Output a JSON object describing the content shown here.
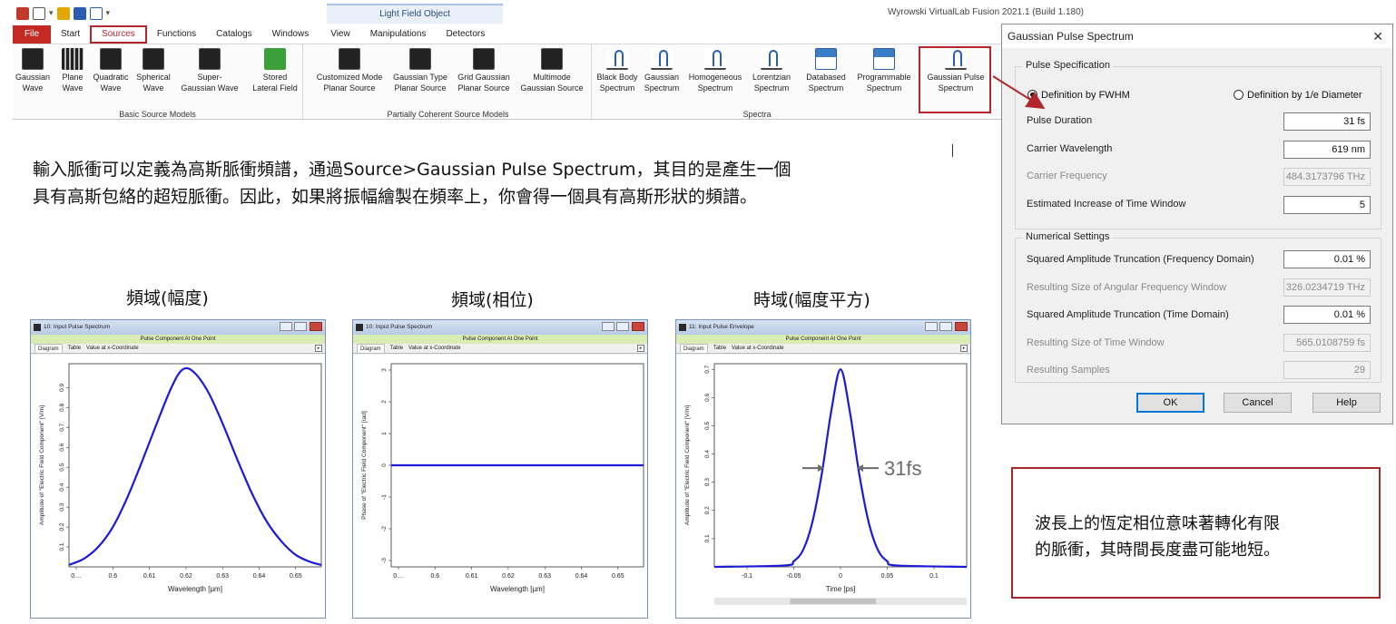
{
  "app": {
    "title": "Wyrowski VirtualLab Fusion 2021.1 (Build 1.180)",
    "context_tab_group": "Light Field Object"
  },
  "tabs": [
    "File",
    "Start",
    "Sources",
    "Functions",
    "Catalogs",
    "Windows",
    "View",
    "Manipulations",
    "Detectors"
  ],
  "ribbon": {
    "groups": [
      {
        "label": "Basic Source Models",
        "buttons": [
          "Gaussian\nWave",
          "Plane\nWave",
          "Quadratic\nWave",
          "Spherical\nWave",
          "Super-\nGaussian Wave",
          "Stored\nLateral Field"
        ]
      },
      {
        "label": "Partially Coherent Source Models",
        "buttons": [
          "Customized Mode\nPlanar Source",
          "Gaussian Type\nPlanar Source",
          "Grid Gaussian\nPlanar Source",
          "Multimode\nGaussian Source"
        ]
      },
      {
        "label": "Spectra",
        "buttons": [
          "Black Body\nSpectrum",
          "Gaussian\nSpectrum",
          "Homogeneous\nSpectrum",
          "Lorentzian\nSpectrum",
          "Databased\nSpectrum",
          "Programmable\nSpectrum",
          "Gaussian Pulse\nSpectrum"
        ]
      }
    ]
  },
  "description": {
    "line1": "輸入脈衝可以定義為高斯脈衝頻譜，通過Source>Gaussian Pulse Spectrum，其目的是產生一個",
    "line2": "具有高斯包絡的超短脈衝。因此，如果將振幅繪製在頻率上，你會得一個具有高斯形狀的頻譜。"
  },
  "captions": [
    "頻域(幅度)",
    "頻域(相位)",
    "時域(幅度平方)"
  ],
  "plots": [
    {
      "window_title": "10: Input Pulse Spectrum",
      "banner": "Pulse Component At One Point",
      "tabs": [
        "Diagram",
        "Table",
        "Value at x-Coordinate"
      ],
      "xlabel": "Wavelength [µm]",
      "ylabel": "Amplitude of \"Electric Field Component\" [V/m]"
    },
    {
      "window_title": "10: Input Pulse Spectrum",
      "banner": "Pulse Component At One Point",
      "tabs": [
        "Diagram",
        "Table",
        "Value at x-Coordinate"
      ],
      "xlabel": "Wavelength [µm]",
      "ylabel": "Phase of \"Electric Field Component\" [rad]"
    },
    {
      "window_title": "11: Input Pulse Envelope",
      "banner": "Pulse Component At One Point",
      "tabs": [
        "Diagram",
        "Table",
        "Value at x-Coordinate"
      ],
      "xlabel": "Time [ps]",
      "ylabel": "Amplitude of \"Electric Field Component\" [V/m]",
      "annotation": "31fs"
    }
  ],
  "chart_data": [
    {
      "type": "line",
      "xlabel": "Wavelength [µm]",
      "ylabel": "Amplitude of \"Electric Field Component\" [V/m]",
      "x_ticks": [
        "0....",
        "0.6",
        "0.61",
        "0.62",
        "0.63",
        "0.64",
        "0.65"
      ],
      "y_ticks": [
        "0.1",
        "0.2",
        "0.3",
        "0.4",
        "0.5",
        "0.6",
        "0.7",
        "0.8",
        "0.9"
      ],
      "xlim": [
        0.588,
        0.657
      ],
      "ylim": [
        0,
        1.02
      ],
      "x": [
        0.588,
        0.592,
        0.596,
        0.6,
        0.604,
        0.608,
        0.612,
        0.616,
        0.619,
        0.622,
        0.626,
        0.63,
        0.634,
        0.638,
        0.642,
        0.646,
        0.65,
        0.654,
        0.657
      ],
      "y": [
        0.01,
        0.04,
        0.1,
        0.2,
        0.35,
        0.53,
        0.72,
        0.9,
        0.99,
        0.98,
        0.88,
        0.72,
        0.54,
        0.37,
        0.23,
        0.13,
        0.06,
        0.025,
        0.01
      ],
      "color": "#1a1ad8"
    },
    {
      "type": "line",
      "xlabel": "Wavelength [µm]",
      "ylabel": "Phase of \"Electric Field Component\" [rad]",
      "x_ticks": [
        "0....",
        "0.6",
        "0.61",
        "0.62",
        "0.63",
        "0.64",
        "0.65"
      ],
      "y_ticks": [
        "-3",
        "-2",
        "-1",
        "0",
        "1",
        "2",
        "3"
      ],
      "xlim": [
        0.588,
        0.657
      ],
      "ylim": [
        -3.2,
        3.2
      ],
      "x": [
        0.588,
        0.657
      ],
      "y": [
        0,
        0
      ],
      "color": "#1a1ad8"
    },
    {
      "type": "line",
      "xlabel": "Time [ps]",
      "ylabel": "Amplitude of \"Electric Field Component\" [V/m]",
      "x_ticks": [
        "-0.1",
        "-0.05",
        "0",
        "0.05",
        "0.1"
      ],
      "y_ticks": [
        "0.1",
        "0.2",
        "0.3",
        "0.4",
        "0.5",
        "0.6",
        "0.7"
      ],
      "xlim": [
        -0.135,
        0.135
      ],
      "ylim": [
        0,
        0.72
      ],
      "x": [
        -0.135,
        -0.06,
        -0.05,
        -0.04,
        -0.03,
        -0.02,
        -0.01,
        0,
        0.01,
        0.02,
        0.03,
        0.04,
        0.05,
        0.06,
        0.135
      ],
      "y": [
        0,
        0.005,
        0.02,
        0.06,
        0.16,
        0.33,
        0.55,
        0.7,
        0.55,
        0.33,
        0.16,
        0.06,
        0.02,
        0.005,
        0
      ],
      "color": "#1a1ad8"
    }
  ],
  "dialog": {
    "title": "Gaussian Pulse Spectrum",
    "close": "✕",
    "pulse_spec": {
      "legend": "Pulse Specification",
      "radio_fwhm": "Definition by FWHM",
      "radio_diameter": "Definition by 1/e Diameter",
      "pulse_duration_label": "Pulse Duration",
      "pulse_duration_value": "31 fs",
      "carrier_wavelength_label": "Carrier Wavelength",
      "carrier_wavelength_value": "619 nm",
      "carrier_frequency_label": "Carrier Frequency",
      "carrier_frequency_value": "484.3173796 THz",
      "time_window_label": "Estimated Increase of Time Window",
      "time_window_value": "5"
    },
    "numerical": {
      "legend": "Numerical Settings",
      "sq_freq_label": "Squared Amplitude Truncation (Frequency Domain)",
      "sq_freq_value": "0.01 %",
      "ang_freq_label": "Resulting Size of Angular Frequency Window",
      "ang_freq_value": "326.0234719 THz",
      "sq_time_label": "Squared Amplitude Truncation (Time Domain)",
      "sq_time_value": "0.01 %",
      "time_window_label": "Resulting Size of Time Window",
      "time_window_value": "565.0108759 fs",
      "samples_label": "Resulting Samples",
      "samples_value": "29"
    },
    "buttons": {
      "ok": "OK",
      "cancel": "Cancel",
      "help": "Help"
    }
  },
  "note": {
    "line1": "波長上的恆定相位意味著轉化有限",
    "line2": "的脈衝，其時間長度盡可能地短。"
  },
  "colors": {
    "highlight": "#b2272b",
    "curve": "#1a1ad8",
    "arrow": "#6b6b6b"
  }
}
